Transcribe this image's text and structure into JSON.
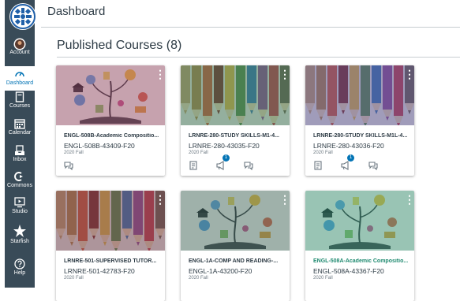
{
  "nav": {
    "items": [
      {
        "label": "Account",
        "icon": "account-avatar-icon"
      },
      {
        "label": "Dashboard",
        "icon": "dashboard-icon"
      },
      {
        "label": "Courses",
        "icon": "courses-icon"
      },
      {
        "label": "Calendar",
        "icon": "calendar-icon"
      },
      {
        "label": "Inbox",
        "icon": "inbox-icon"
      },
      {
        "label": "Commons",
        "icon": "commons-icon"
      },
      {
        "label": "Studio",
        "icon": "studio-icon"
      },
      {
        "label": "Starfish",
        "icon": "starfish-icon"
      },
      {
        "label": "Help",
        "icon": "help-icon"
      }
    ]
  },
  "header": {
    "title": "Dashboard"
  },
  "section": {
    "title": "Published Courses (8)"
  },
  "courses": [
    {
      "title": "ENGL-508B-Academic Compositio...",
      "code": "ENGL-508B-43409-F20",
      "term": "2020 Fall",
      "image": "books",
      "tint": "#8b3a62",
      "badge": ""
    },
    {
      "title": "LRNRE-280-STUDY SKILLS-M1-4...",
      "code": "LRNRE-280-43035-F20",
      "term": "2020 Fall",
      "image": "pencils",
      "tint": "#1f6b57",
      "badge": "1"
    },
    {
      "title": "LRNRE-280-STUDY SKILLS-M1L-4...",
      "code": "LRNRE-280-43036-F20",
      "term": "2020 Fall",
      "image": "pencils",
      "tint": "#3b3f9a",
      "badge": "1"
    },
    {
      "title": "LRNRE-501-SUPERVISED TUTOR...",
      "code": "LRNRE-501-42783-F20",
      "term": "2020 Fall",
      "image": "pencils",
      "tint": "#5b2d50",
      "badge": ""
    },
    {
      "title": "ENGL-1A-COMP AND READING-...",
      "code": "ENGL-1A-43200-F20",
      "term": "2020 Fall",
      "image": "books",
      "tint": "#2e5c57",
      "badge": ""
    },
    {
      "title": "ENGL-508A-Academic Compositio...",
      "code": "ENGL-508A-43367-F20",
      "term": "2020 Fall",
      "image": "books",
      "tint": "#1f8a70",
      "badge": ""
    }
  ],
  "colors": {
    "nav_bg": "#394b58",
    "accent": "#0374b5"
  }
}
